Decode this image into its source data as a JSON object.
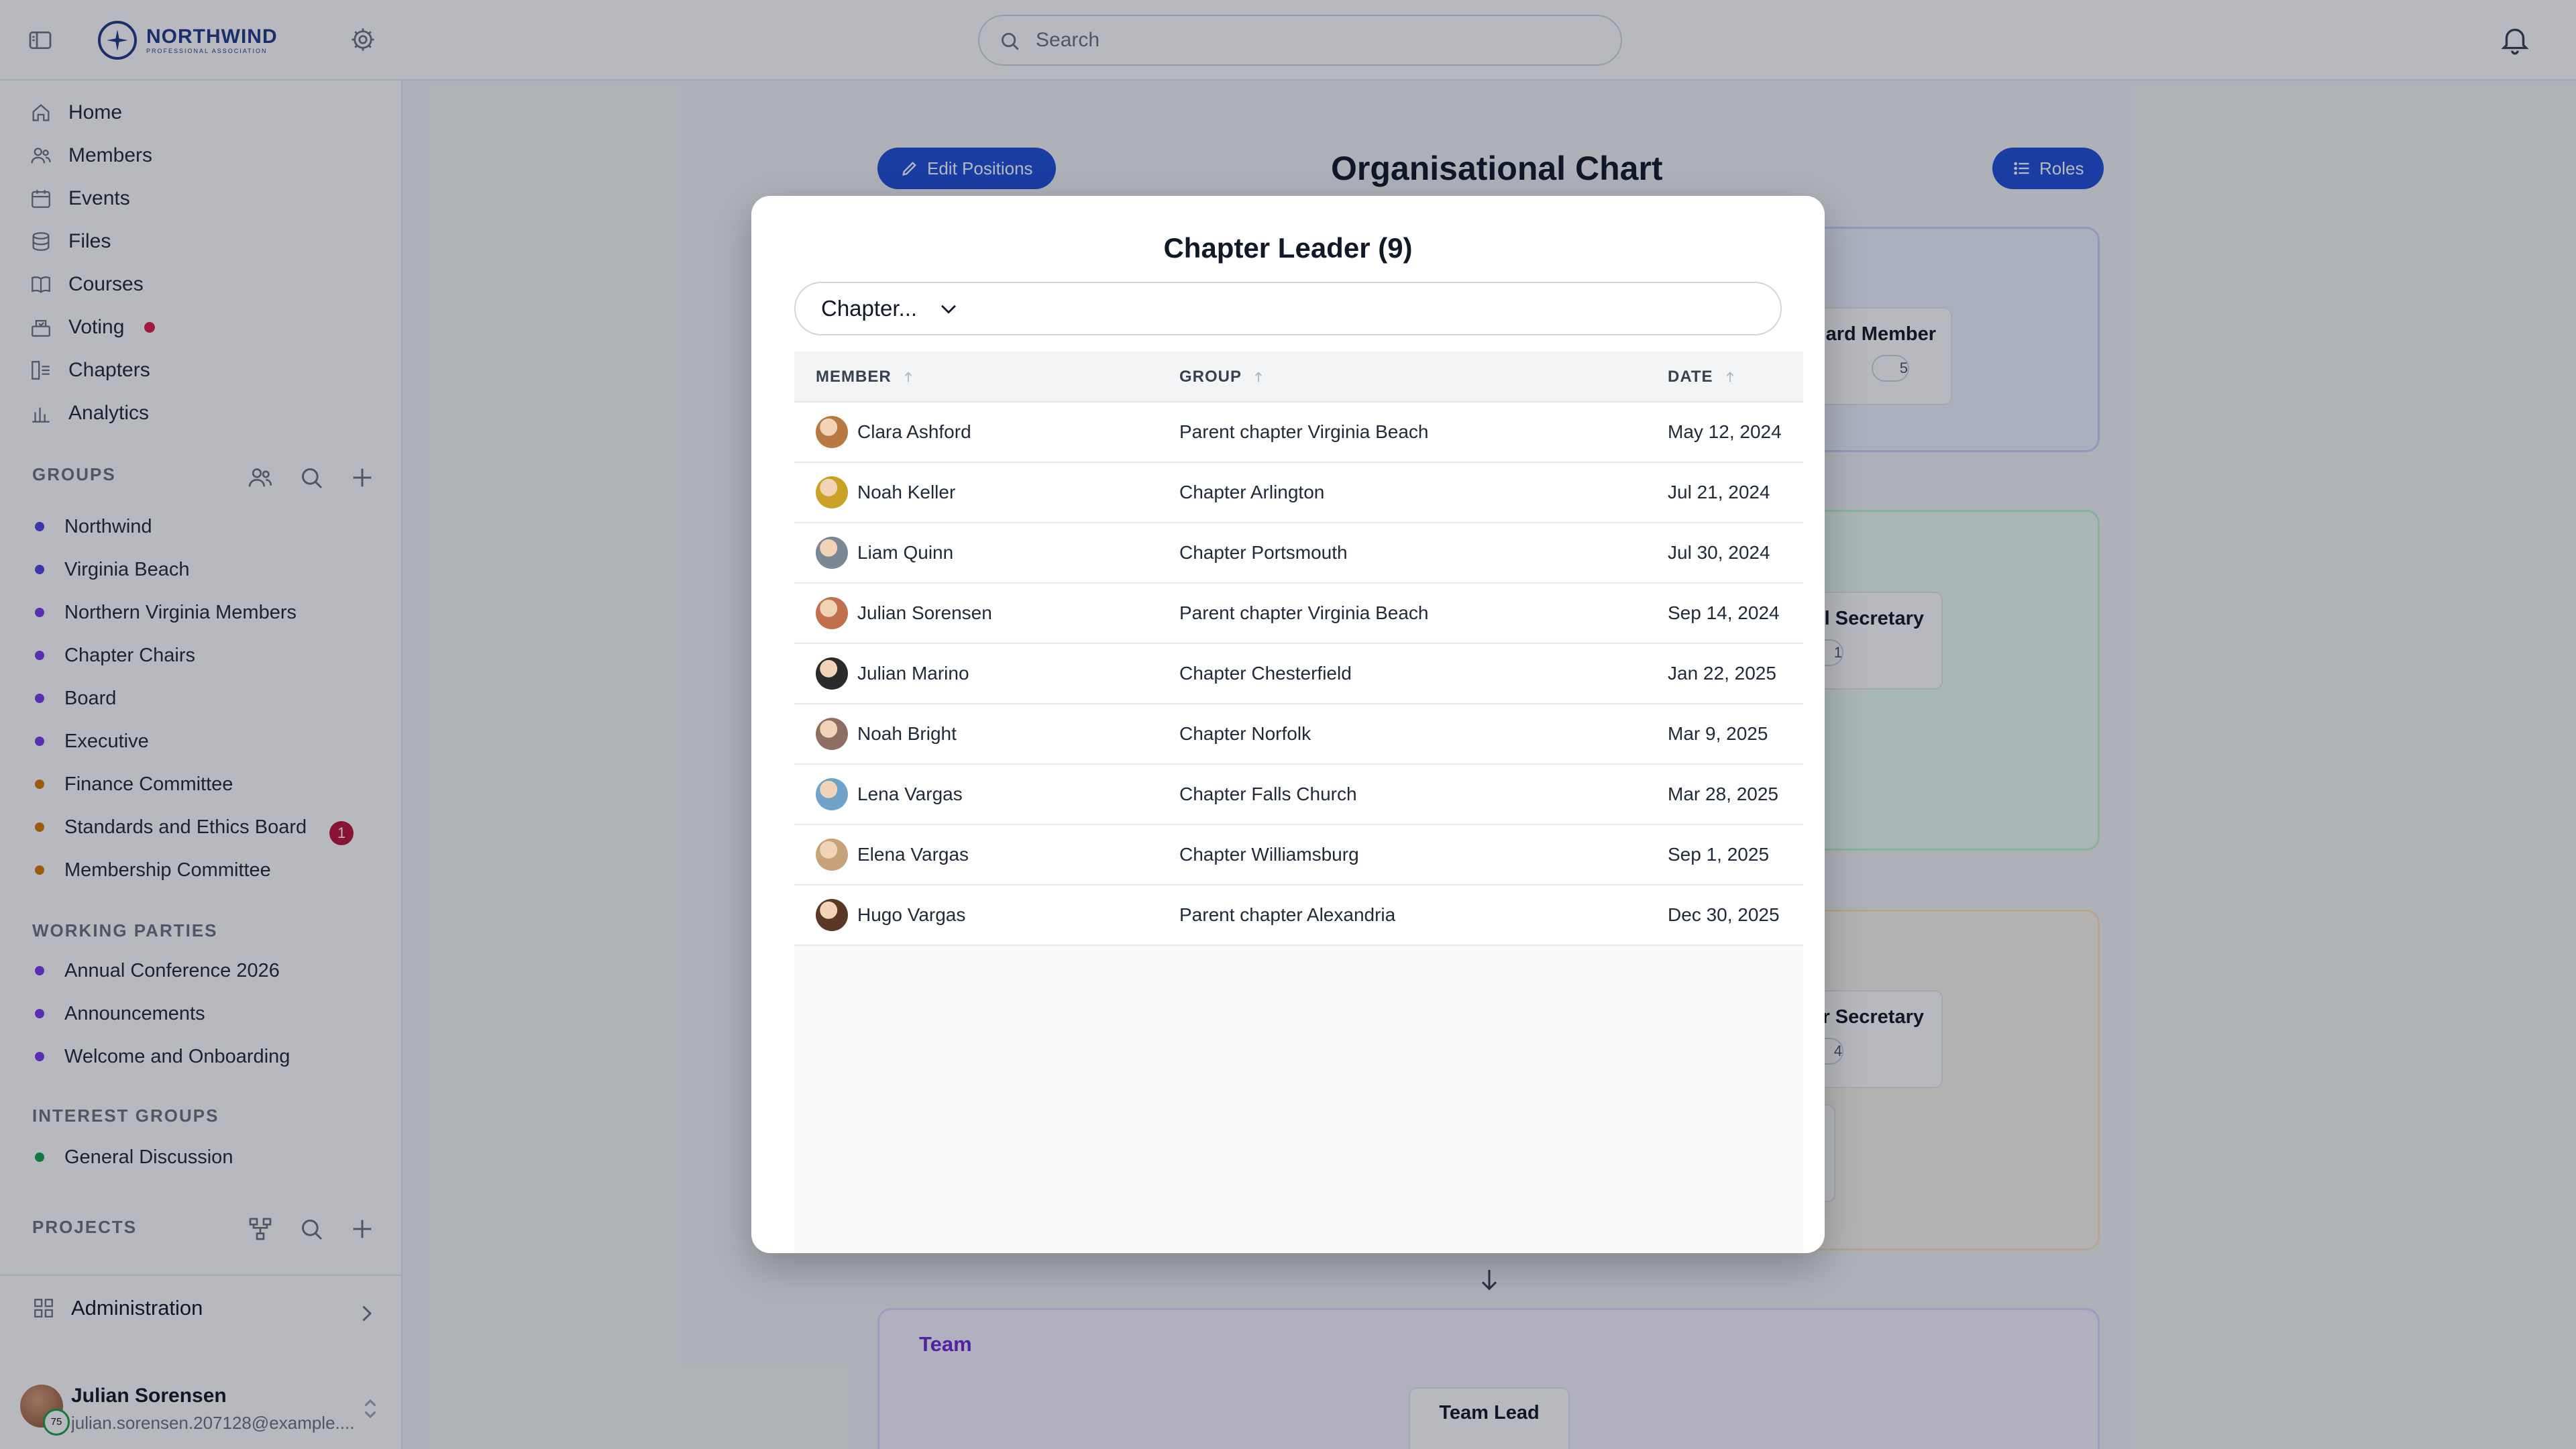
{
  "brand": {
    "name": "NORTHWIND",
    "tagline": "PROFESSIONAL ASSOCIATION"
  },
  "search": {
    "placeholder": "Search"
  },
  "nav": [
    {
      "label": "Home",
      "icon": "home-icon"
    },
    {
      "label": "Members",
      "icon": "users-icon"
    },
    {
      "label": "Events",
      "icon": "calendar-icon"
    },
    {
      "label": "Files",
      "icon": "database-icon"
    },
    {
      "label": "Courses",
      "icon": "book-icon"
    },
    {
      "label": "Voting",
      "icon": "ballot-icon",
      "dot": true
    },
    {
      "label": "Chapters",
      "icon": "chapters-icon"
    },
    {
      "label": "Analytics",
      "icon": "chart-icon"
    }
  ],
  "groups": {
    "title": "GROUPS",
    "items": [
      {
        "label": "Northwind",
        "color": "#4f46e5"
      },
      {
        "label": "Virginia Beach",
        "color": "#4f46e5"
      },
      {
        "label": "Northern Virginia Members",
        "color": "#7c3aed"
      },
      {
        "label": "Chapter Chairs",
        "color": "#7c3aed"
      },
      {
        "label": "Board",
        "color": "#7c3aed"
      },
      {
        "label": "Executive",
        "color": "#7c3aed"
      },
      {
        "label": "Finance Committee",
        "color": "#d97706"
      },
      {
        "label": "Standards and Ethics Board",
        "color": "#d97706",
        "badge": "1"
      },
      {
        "label": "Membership Committee",
        "color": "#d97706"
      }
    ]
  },
  "working_parties": {
    "title": "WORKING PARTIES",
    "items": [
      {
        "label": "Annual Conference 2026",
        "color": "#7c3aed"
      },
      {
        "label": "Announcements",
        "color": "#7c3aed"
      },
      {
        "label": "Welcome and Onboarding",
        "color": "#7c3aed"
      }
    ]
  },
  "interest_groups": {
    "title": "INTEREST GROUPS",
    "items": [
      {
        "label": "General Discussion",
        "color": "#16a34a"
      }
    ]
  },
  "projects": {
    "title": "PROJECTS"
  },
  "administration": {
    "label": "Administration"
  },
  "user": {
    "name": "Julian Sorensen",
    "email": "julian.sorensen.207128@example....",
    "badge": "75"
  },
  "main": {
    "title": "Organisational Chart",
    "edit_positions": "Edit Positions",
    "roles": "Roles",
    "bg_roles": [
      {
        "label": "ard Member",
        "count": "5"
      },
      {
        "label": "l Secretary",
        "count": "1"
      },
      {
        "label": "r Secretary",
        "count": "4"
      }
    ],
    "team": {
      "title": "Team",
      "lead": "Team Lead"
    }
  },
  "modal": {
    "title": "Chapter Leader (9)",
    "filter": "Chapter...",
    "columns": [
      "MEMBER",
      "GROUP",
      "DATE"
    ],
    "rows": [
      {
        "member": "Clara Ashford",
        "group": "Parent chapter Virginia Beach",
        "date": "May 12, 2024",
        "avatar": "#b7793f"
      },
      {
        "member": "Noah Keller",
        "group": "Chapter Arlington",
        "date": "Jul 21, 2024",
        "avatar": "#c9a227"
      },
      {
        "member": "Liam Quinn",
        "group": "Chapter Portsmouth",
        "date": "Jul 30, 2024",
        "avatar": "#7b8794"
      },
      {
        "member": "Julian Sorensen",
        "group": "Parent chapter Virginia Beach",
        "date": "Sep 14, 2024",
        "avatar": "#c0704d"
      },
      {
        "member": "Julian Marino",
        "group": "Chapter Chesterfield",
        "date": "Jan 22, 2025",
        "avatar": "#2b2b2b"
      },
      {
        "member": "Noah Bright",
        "group": "Chapter Norfolk",
        "date": "Mar 9, 2025",
        "avatar": "#8d6e63"
      },
      {
        "member": "Lena Vargas",
        "group": "Chapter Falls Church",
        "date": "Mar 28, 2025",
        "avatar": "#6fa3c8"
      },
      {
        "member": "Elena Vargas",
        "group": "Chapter Williamsburg",
        "date": "Sep 1, 2025",
        "avatar": "#c8a27a"
      },
      {
        "member": "Hugo Vargas",
        "group": "Parent chapter Alexandria",
        "date": "Dec 30, 2025",
        "avatar": "#5a3825"
      }
    ]
  }
}
